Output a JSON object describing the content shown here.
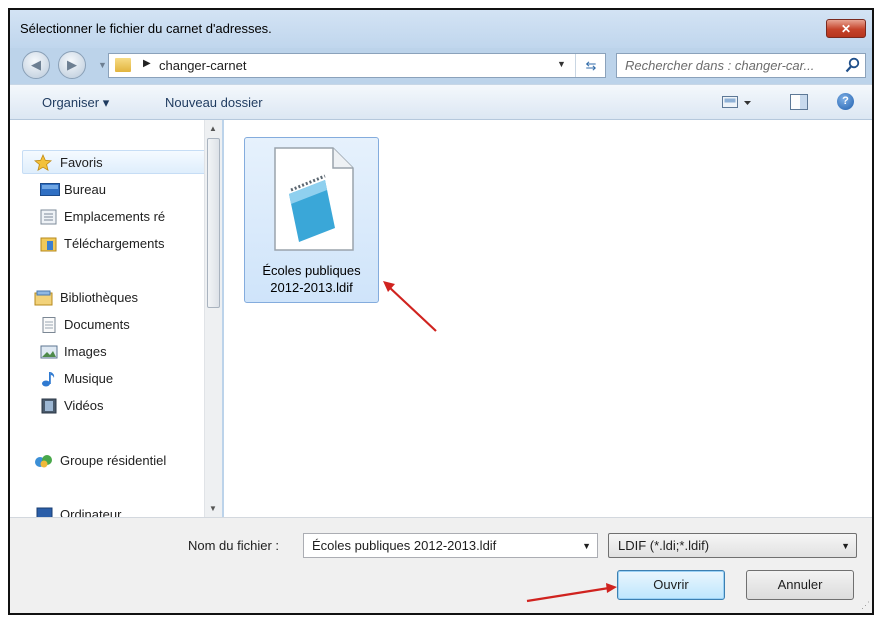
{
  "window": {
    "title": "Sélectionner le fichier du carnet d'adresses.",
    "close_label": "✕"
  },
  "address": {
    "breadcrumb": [
      "changer-carnet"
    ],
    "search_placeholder": "Rechercher dans : changer-car..."
  },
  "toolbar": {
    "organize_label": "Organiser ▾",
    "new_folder_label": "Nouveau dossier"
  },
  "nav": {
    "favorites": {
      "label": "Favoris",
      "items": [
        "Bureau",
        "Emplacements ré",
        "Téléchargements"
      ]
    },
    "libraries": {
      "label": "Bibliothèques",
      "items": [
        "Documents",
        "Images",
        "Musique",
        "Vidéos"
      ]
    },
    "homegroup": "Groupe résidentiel",
    "computer": "Ordinateur"
  },
  "files": [
    {
      "name_line1": "Écoles publiques",
      "name_line2": "2012-2013.ldif",
      "selected": true
    }
  ],
  "bottom": {
    "filename_label": "Nom du fichier :",
    "filename_value": "Écoles publiques 2012-2013.ldif",
    "filter_value": "LDIF (*.ldi;*.ldif)",
    "open_label": "Ouvrir",
    "cancel_label": "Annuler"
  },
  "colors": {
    "annotation_arrow": "#d0231f",
    "selection": "#cfe4fa",
    "title_bg": "#c9dcf0"
  }
}
